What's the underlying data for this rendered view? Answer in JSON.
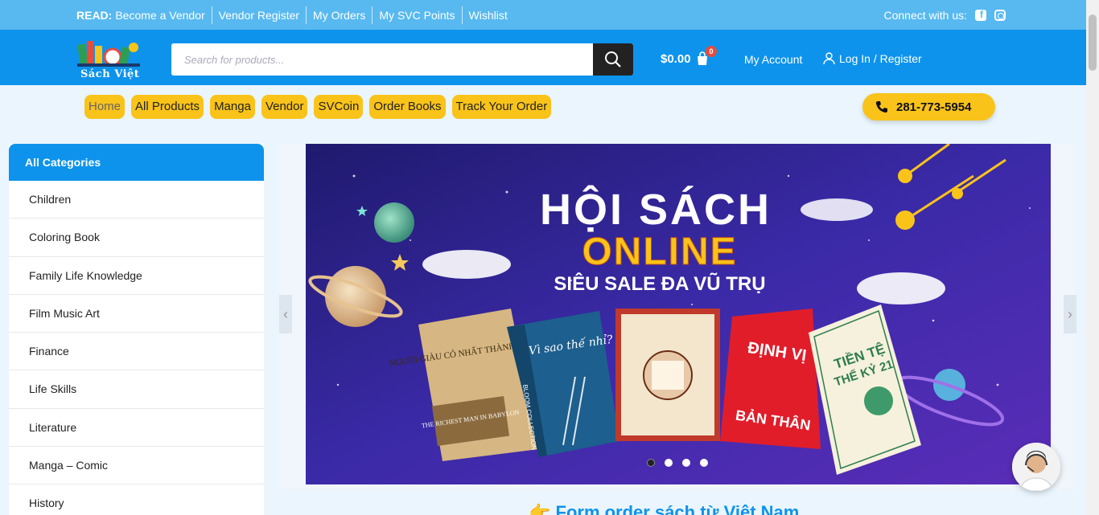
{
  "topbar": {
    "lead": "READ:",
    "links": [
      "Become a Vendor",
      "Vendor Register",
      "My Orders",
      "My SVC Points",
      "Wishlist"
    ],
    "connect": "Connect with us:"
  },
  "header": {
    "logo_text": "Sách Việt",
    "search_placeholder": "Search for products...",
    "cart_total": "$0.00",
    "cart_count": "0",
    "my_account": "My Account",
    "login": "Log In / Register"
  },
  "nav": {
    "items": [
      "Home",
      "All Products",
      "Manga",
      "Vendor",
      "SVCoin",
      "Order Books",
      "Track Your Order"
    ],
    "phone": "281-773-5954"
  },
  "sidebar": {
    "title": "All Categories",
    "categories": [
      "Children",
      "Coloring Book",
      "Family Life Knowledge",
      "Film Music Art",
      "Finance",
      "Life Skills",
      "Literature",
      "Manga – Comic",
      "History"
    ]
  },
  "banner": {
    "line1": "HỘI SÁCH",
    "line2": "ONLINE",
    "line3": "SIÊU SALE ĐA VŨ TRỤ",
    "book1_title": "NGƯỜI GIÀU CÓ NHẤT THÀNH BABYLON",
    "book1_sub": "THE RICHEST MAN IN BABYLON",
    "book2_title": "Vì sao thế nhỉ?",
    "book2_spine": "BLOOM COLLECTION",
    "book4_title": "ĐỊNH VỊ BẢN THÂN",
    "book5_title": "TIỀN TỆ THẾ KỶ 21",
    "slides": 4,
    "active_slide": 1
  },
  "section_title": "👉 Form order sách từ Việt Nam",
  "colors": {
    "topbar": "#58b9f0",
    "header": "#0d93ec",
    "accent": "#f9c31a"
  }
}
